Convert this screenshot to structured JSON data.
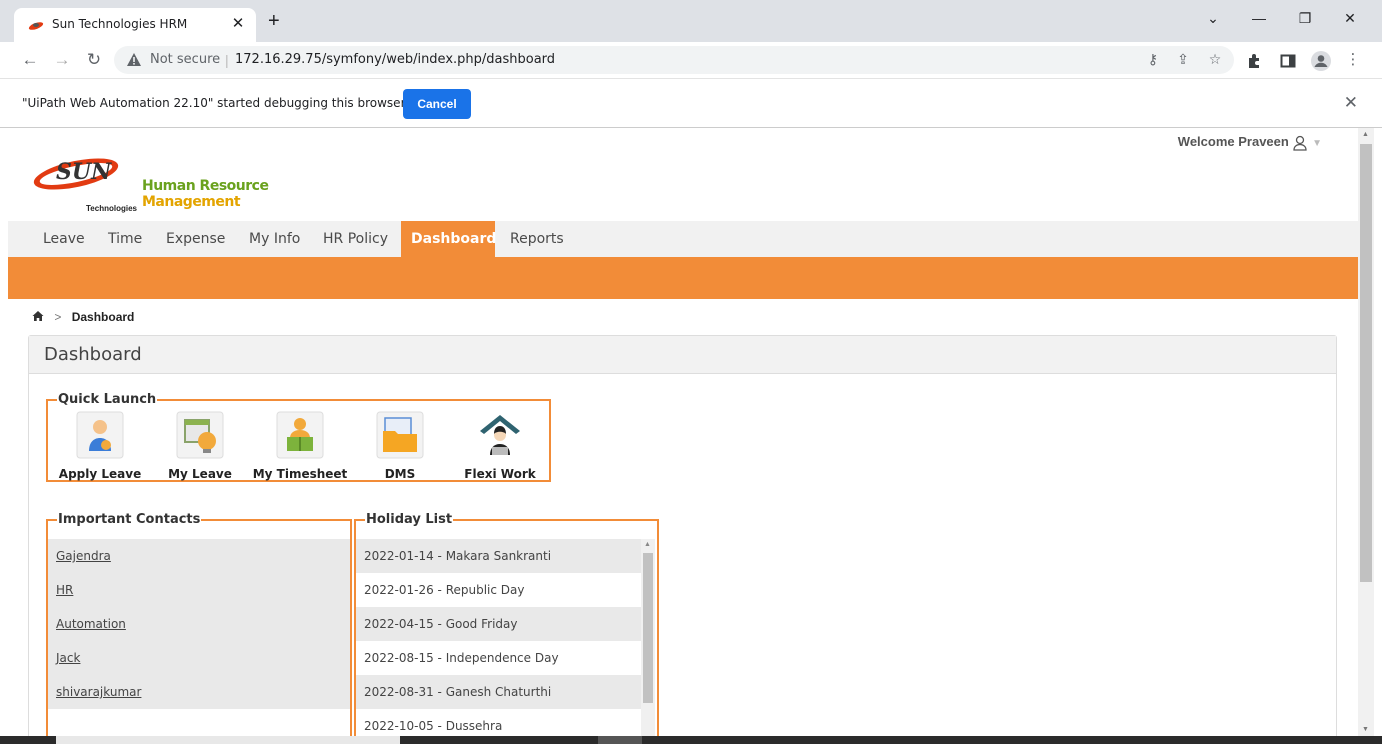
{
  "browser": {
    "tab_title": "Sun Technologies HRM",
    "tab_close": "✕",
    "new_tab": "+",
    "security_label": "Not secure",
    "url": "172.16.29.75/symfony/web/index.php/dashboard",
    "window_minimize": "—",
    "window_restore": "❐",
    "window_close": "✕",
    "back": "←",
    "forward": "→",
    "reload": "↻",
    "debug_message": "\"UiPath Web Automation 22.10\" started debugging this browser",
    "debug_cancel": "Cancel",
    "debug_close": "✕"
  },
  "header": {
    "logo_hr": "Human Resource",
    "logo_mgmt": "Management",
    "logo_sub": "Technologies",
    "welcome": "Welcome Praveen",
    "welcome_caret": "▼"
  },
  "menu": {
    "items": [
      {
        "label": "Leave"
      },
      {
        "label": "Time"
      },
      {
        "label": "Expense"
      },
      {
        "label": "My Info"
      },
      {
        "label": "HR Policy"
      },
      {
        "label": "Dashboard"
      },
      {
        "label": "Reports"
      }
    ],
    "active_index": 5
  },
  "breadcrumb": {
    "separator": ">",
    "current": "Dashboard"
  },
  "dashboard": {
    "title": "Dashboard",
    "quick_launch": {
      "legend": "Quick Launch",
      "items": [
        {
          "label": "Apply Leave",
          "icon": "apply-leave-icon"
        },
        {
          "label": "My Leave",
          "icon": "my-leave-icon"
        },
        {
          "label": "My Timesheet",
          "icon": "my-timesheet-icon"
        },
        {
          "label": "DMS",
          "icon": "dms-folder-icon"
        },
        {
          "label": "Flexi Work",
          "icon": "flexi-work-icon"
        }
      ]
    },
    "contacts": {
      "legend": "Important Contacts",
      "items": [
        "Gajendra",
        "HR",
        "Automation",
        "Jack",
        "shivarajkumar"
      ]
    },
    "holidays": {
      "legend": "Holiday List",
      "items": [
        "2022-01-14 - Makara Sankranti",
        "2022-01-26 - Republic Day",
        "2022-04-15 - Good Friday",
        "2022-08-15 - Independence Day",
        "2022-08-31 - Ganesh Chaturthi",
        "2022-10-05 - Dussehra"
      ]
    }
  },
  "colors": {
    "accent": "#f28c38",
    "chrome_blue": "#1a73e8"
  }
}
